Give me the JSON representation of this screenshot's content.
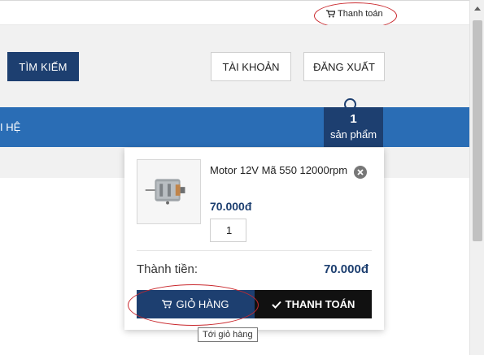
{
  "topbar": {
    "checkout_link": "Thanh toán",
    "icon": "cart-icon"
  },
  "header": {
    "search_button": "TÌM KIẾM",
    "account_button": "TÀI KHOẢN",
    "logout_button": "ĐĂNG XUẤT"
  },
  "nav": {
    "partial_item": "I HỆ"
  },
  "cart_tab": {
    "count": "1",
    "label": "sản phẩm"
  },
  "dropdown": {
    "item": {
      "name": "Motor 12V Mã 550 12000rpm",
      "price": "70.000đ",
      "quantity": "1",
      "remove_icon": "close-circle-icon"
    },
    "total_label": "Thành tiền:",
    "total_value": "70.000đ",
    "cart_button": "GIỎ HÀNG",
    "checkout_button": "THANH TOÁN"
  },
  "tooltip": "Tới giỏ hàng",
  "colors": {
    "navy": "#1d3f70",
    "nav_blue": "#2a6db5",
    "annotation_red": "#c9282d",
    "checkout_black": "#111111"
  }
}
